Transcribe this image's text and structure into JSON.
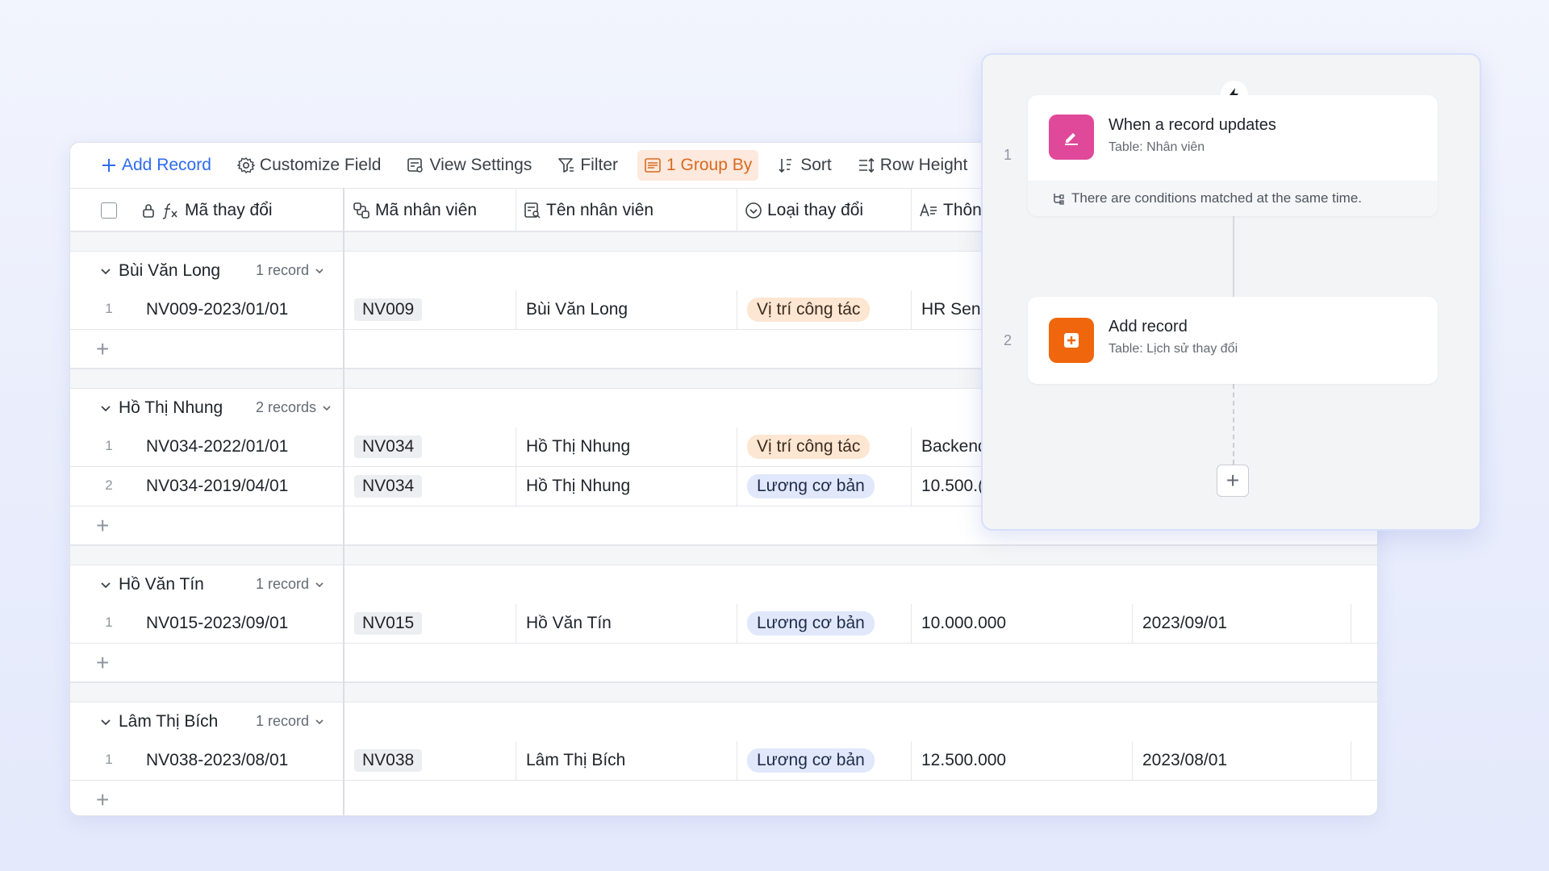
{
  "toolbar": {
    "add_record": "Add Record",
    "customize_field": "Customize Field",
    "view_settings": "View Settings",
    "filter": "Filter",
    "group_by": "1 Group By",
    "sort": "Sort",
    "row_height": "Row Height"
  },
  "columns": {
    "ma_thay_doi": "Mã thay đổi",
    "ma_nhan_vien": "Mã nhân viên",
    "ten_nhan_vien": "Tên nhân viên",
    "loai_thay_doi": "Loại thay đổi",
    "thong_tin": "Thôn"
  },
  "groups": [
    {
      "title": "Bùi Văn Long",
      "count": "1 record",
      "rows": [
        {
          "num": "1",
          "code": "NV009-2023/01/01",
          "emp_id": "NV009",
          "name": "Bùi Văn Long",
          "type": "Vị trí công tác",
          "info": "HR Seni",
          "date": ""
        }
      ]
    },
    {
      "title": "Hồ Thị Nhung",
      "count": "2 records",
      "rows": [
        {
          "num": "1",
          "code": "NV034-2022/01/01",
          "emp_id": "NV034",
          "name": "Hồ Thị Nhung",
          "type": "Vị trí công tác",
          "info": "Backend",
          "date": ""
        },
        {
          "num": "2",
          "code": "NV034-2019/04/01",
          "emp_id": "NV034",
          "name": "Hồ Thị Nhung",
          "type": "Lương cơ bản",
          "info": "10.500.(",
          "date": ""
        }
      ]
    },
    {
      "title": "Hồ Văn Tín",
      "count": "1 record",
      "rows": [
        {
          "num": "1",
          "code": "NV015-2023/09/01",
          "emp_id": "NV015",
          "name": "Hồ Văn Tín",
          "type": "Lương cơ bản",
          "info": "10.000.000",
          "date": "2023/09/01"
        }
      ]
    },
    {
      "title": "Lâm Thị Bích",
      "count": "1 record",
      "rows": [
        {
          "num": "1",
          "code": "NV038-2023/08/01",
          "emp_id": "NV038",
          "name": "Lâm Thị Bích",
          "type": "Lương cơ bản",
          "info": "12.500.000",
          "date": "2023/08/01"
        }
      ]
    }
  ],
  "automation": {
    "step1": {
      "num": "1",
      "title": "When a record updates",
      "subtitle": "Table: Nhân viên",
      "condition": "There are conditions matched at the same time."
    },
    "step2": {
      "num": "2",
      "title": "Add record",
      "subtitle": "Table: Lịch sử thay đổi"
    }
  },
  "colors": {
    "accent_blue": "#2f6bf0",
    "trigger_icon": "#e0489a",
    "action_icon": "#f0660c",
    "pill_orange": "#fde6d2",
    "pill_blue": "#e1e8fb"
  }
}
